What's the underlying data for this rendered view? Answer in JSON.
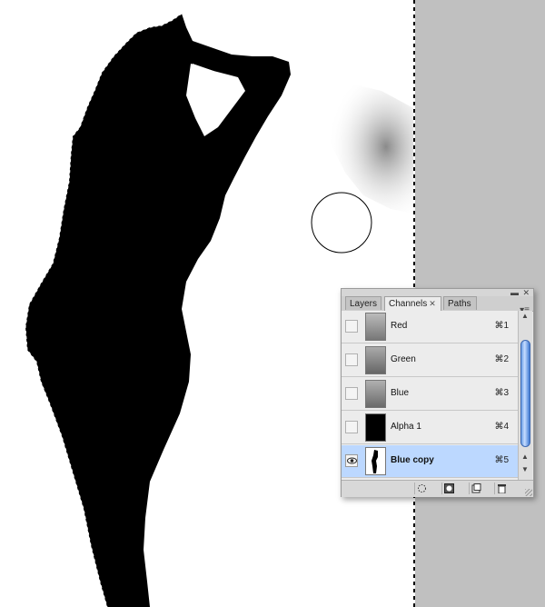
{
  "panel": {
    "tabs": [
      {
        "label": "Layers"
      },
      {
        "label": "Channels",
        "close": "✕"
      },
      {
        "label": "Paths"
      }
    ],
    "collapse_glyph": "▬",
    "close_glyph": "✕",
    "menu_glyph": "▾≡"
  },
  "channels": [
    {
      "name": "Red",
      "shortcut": "⌘1",
      "visible": false,
      "selected": false
    },
    {
      "name": "Green",
      "shortcut": "⌘2",
      "visible": false,
      "selected": false
    },
    {
      "name": "Blue",
      "shortcut": "⌘3",
      "visible": false,
      "selected": false
    },
    {
      "name": "Alpha 1",
      "shortcut": "⌘4",
      "visible": false,
      "selected": false
    },
    {
      "name": "Blue copy",
      "shortcut": "⌘5",
      "visible": true,
      "selected": true
    }
  ],
  "scroll_glyphs": {
    "up_top": "▲",
    "up": "▲",
    "down": "▼"
  },
  "colors": {
    "selection_highlight": "#bcd8ff",
    "pasteboard": "#c0c0c0",
    "scroll_thumb": "#6b9fe6"
  },
  "icons": [
    "eye-icon",
    "load-selection-icon",
    "save-selection-icon",
    "new-channel-icon",
    "trash-icon",
    "brush-cursor-icon"
  ]
}
